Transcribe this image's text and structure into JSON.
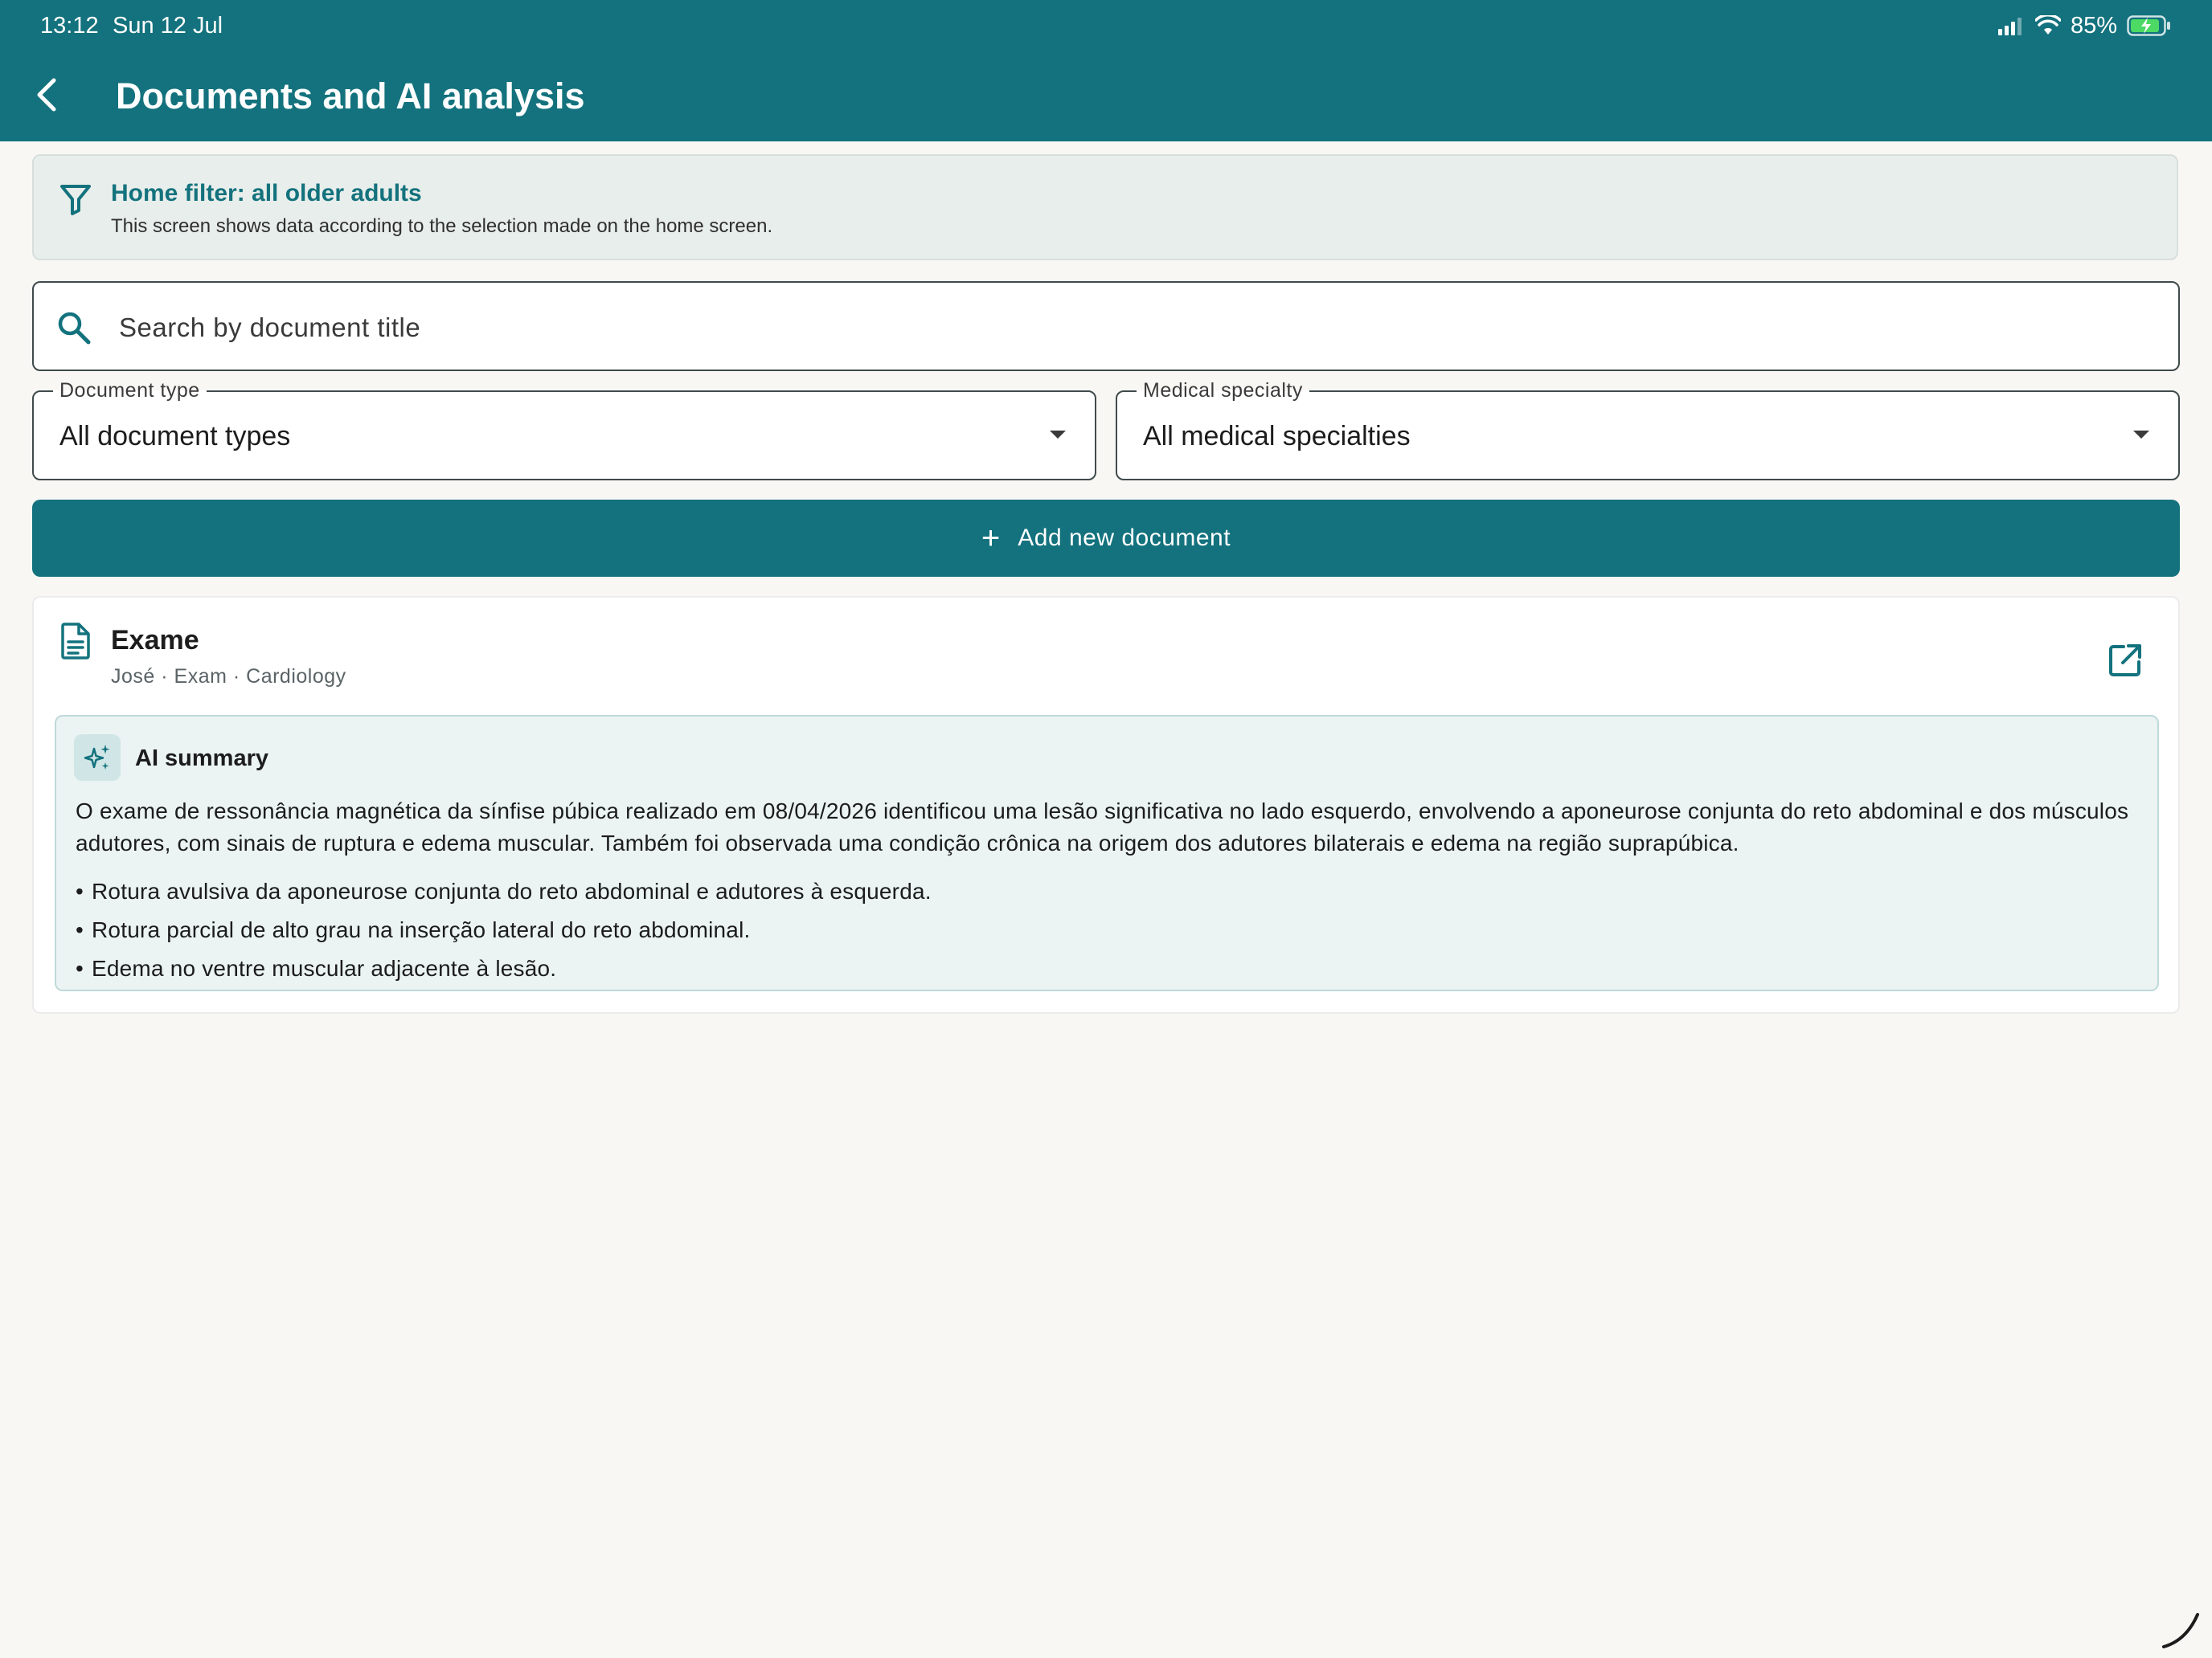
{
  "status_bar": {
    "time": "13:12",
    "date": "Sun 12 Jul",
    "battery": "85%"
  },
  "header": {
    "title": "Documents and AI analysis"
  },
  "filter_banner": {
    "title": "Home filter: all older adults",
    "description": "This screen shows data according to the selection made on the home screen."
  },
  "search": {
    "placeholder": "Search by document title",
    "value": ""
  },
  "filters": {
    "document_type": {
      "label": "Document type",
      "value": "All document types"
    },
    "medical_specialty": {
      "label": "Medical specialty",
      "value": "All medical specialties"
    }
  },
  "add_button": {
    "icon": "+",
    "label": "Add new document"
  },
  "documents": [
    {
      "title": "Exame",
      "meta": "José · Exam · Cardiology",
      "ai_summary": {
        "title": "AI summary",
        "text": "O exame de ressonância magnética da sínfise púbica realizado em 08/04/2026 identificou uma lesão significativa no lado esquerdo, envolvendo a aponeurose conjunta do reto abdominal e dos músculos adutores, com sinais de ruptura e edema muscular. Também foi observada uma condição crônica na origem dos adutores bilaterais e edema na região suprapúbica.",
        "bullets": [
          "Rotura avulsiva da aponeurose conjunta do reto abdominal e adutores à esquerda.",
          "Rotura parcial de alto grau na inserção lateral do reto abdominal.",
          "Edema no ventre muscular adjacente à lesão."
        ]
      }
    }
  ],
  "colors": {
    "primary": "#13727D",
    "background": "#F8F7F4",
    "banner_bg": "#E8EEEB",
    "ai_bg": "#EBF3F3"
  },
  "icons": {
    "back": "chevron-left-icon",
    "filter": "filter-funnel-icon",
    "search": "search-icon",
    "document": "document-icon",
    "open": "open-external-icon",
    "ai": "sparkles-icon"
  }
}
